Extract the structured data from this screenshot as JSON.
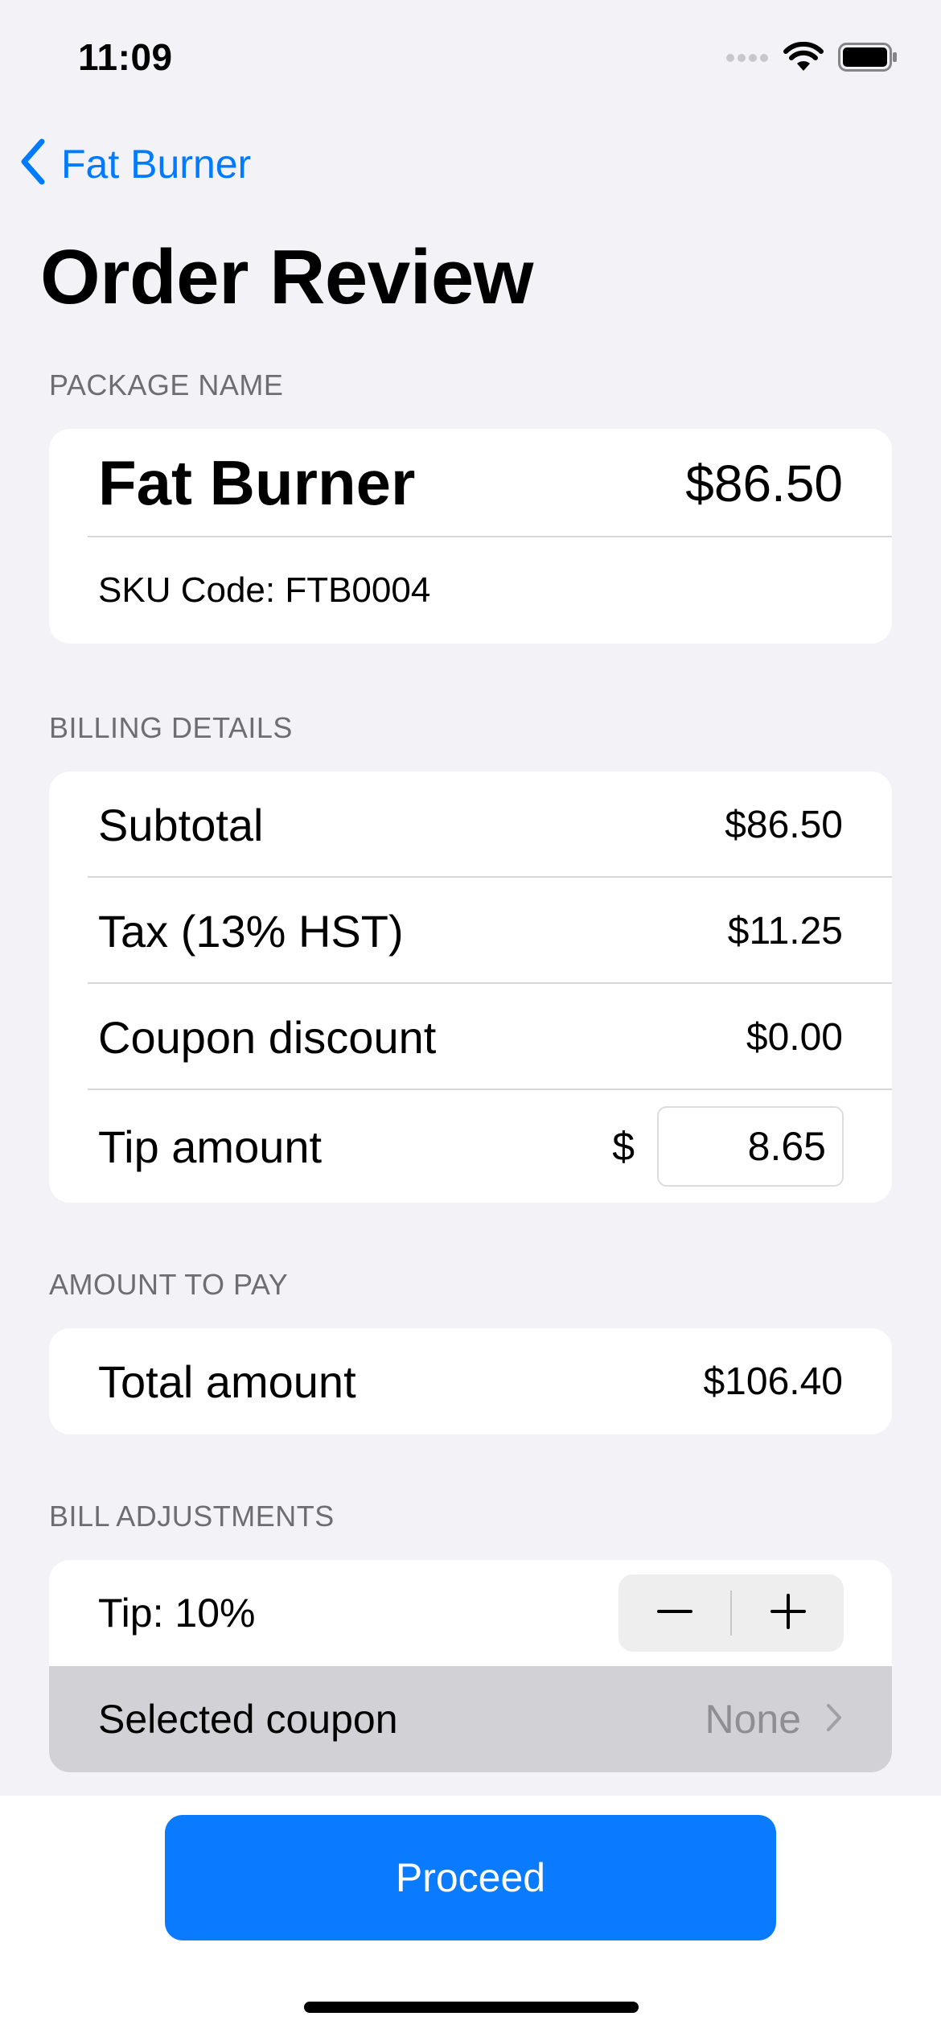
{
  "status_bar": {
    "time": "11:09",
    "icons": [
      "cellular-dots-icon",
      "wifi-icon",
      "battery-icon"
    ]
  },
  "nav": {
    "back_label": "Fat Burner",
    "back_icon": "chevron-left-icon",
    "title": "Order Review"
  },
  "package": {
    "header": "PACKAGE NAME",
    "name": "Fat Burner",
    "price": "$86.50",
    "sku": "SKU Code: FTB0004"
  },
  "billing": {
    "header": "BILLING DETAILS",
    "subtotal_label": "Subtotal",
    "subtotal_value": "$86.50",
    "tax_label": "Tax (13% HST)",
    "tax_value": "$11.25",
    "coupon_label": "Coupon discount",
    "coupon_value": "$0.00",
    "tip_label": "Tip amount",
    "tip_currency": "$",
    "tip_value": "8.65"
  },
  "amount": {
    "header": "AMOUNT TO PAY",
    "total_label": "Total amount",
    "total_value": "$106.40"
  },
  "adjustments": {
    "header": "BILL ADJUSTMENTS",
    "tip_label": "Tip: 10%",
    "coupon_label": "Selected coupon",
    "coupon_value": "None"
  },
  "actions": {
    "proceed_label": "Proceed"
  },
  "colors": {
    "accent": "#0A7AFF",
    "background": "#F2F2F7",
    "highlight_row": "#D1D1D6"
  }
}
